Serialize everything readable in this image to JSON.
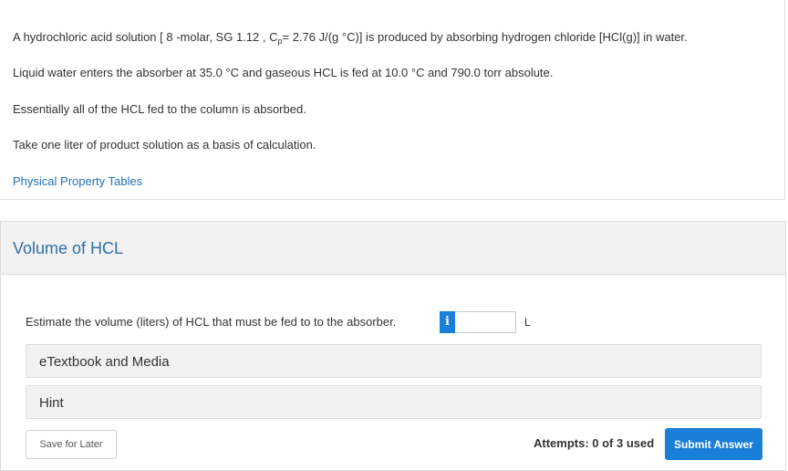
{
  "problem": {
    "line1_a": "A hydrochloric acid solution [ 8 -molar, SG 1.12 , C",
    "line1_sub": "p",
    "line1_b": "= 2.76 J/(g °C)] is produced by absorbing hydrogen chloride [HCl(g)] in water.",
    "line2": "Liquid water enters the absorber at 35.0 °C and gaseous HCL is fed at 10.0 °C and 790.0 torr absolute.",
    "line3": "Essentially all of the HCL fed to the column is absorbed.",
    "line4": "Take one liter of product solution as a basis of calculation.",
    "link": "Physical Property Tables"
  },
  "question": {
    "title": "Volume of HCL",
    "prompt": "Estimate the volume (liters) of HCL that must be fed to to the absorber.",
    "info_icon": "i",
    "answer_value": "",
    "unit": "L",
    "etextbook_label": "eTextbook and Media",
    "hint_label": "Hint",
    "save_label": "Save for Later",
    "attempts_text": "Attempts: 0 of 3 used",
    "submit_label": "Submit Answer"
  },
  "colors": {
    "accent": "#1a7fd8",
    "link": "#1f72b8",
    "title": "#2f6fa7",
    "panel_bg": "#f2f2f2"
  }
}
